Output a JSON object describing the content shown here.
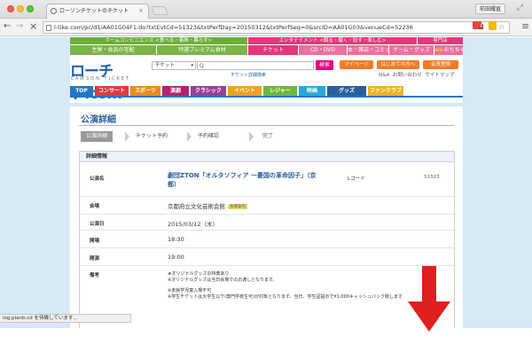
{
  "browser": {
    "tab_title": "ローソンチケットのチケット",
    "profile_label": "前田耀直",
    "url": "l-tike.com/pc/d1/AA01G04F1.do?txtEvtCd=51323&txtPerfDay=20150312&txtPerfSeq=0&srcID=AA01G03&venueCd=52236",
    "status_text": "log.pianb.cd を待機しています..."
  },
  "header": {
    "categories_top": [
      {
        "label": "ホームコンビニエンス <食べる・着飾・暮らす>",
        "color": "#6aae3c"
      },
      {
        "label": "エンタテイメント <観る・聴く・話す・楽しむ>",
        "color": "#e7367a"
      },
      {
        "label": "専門店",
        "color": "#e7367a"
      }
    ],
    "categories_sub": [
      {
        "label": "生鮮・食品の宅配",
        "color": "#7bb54a"
      },
      {
        "label": "特選プレミアム食材",
        "color": "#7bb54a"
      },
      {
        "label": "チケット",
        "color": "#e7367a"
      },
      {
        "label": "CD・DVD",
        "color": "#ef6fa0"
      },
      {
        "label": "本・雑誌・コミック",
        "color": "#ef6fa0"
      },
      {
        "label": "ゲーム・グッズ",
        "color": "#ef6fa0"
      },
      {
        "label": "おもちゃ",
        "color": "#ef6fa0",
        "badge": "NEW"
      }
    ],
    "logo_main": "ローチケ.com",
    "logo_sub": "LAWSON TICKET",
    "search": {
      "select_value": "チケット",
      "query": "Q",
      "button_label": "検索",
      "detail_link": "チケット詳細検索"
    },
    "buttons": [
      {
        "label": "マイページ",
        "color": "#f07c2a"
      },
      {
        "label": "はじめての方へ",
        "color": "#f07c2a"
      },
      {
        "label": "会員登録",
        "color": "#f07c2a"
      }
    ],
    "links": [
      "Q&A",
      "お問い合わせ",
      "サイトマップ"
    ],
    "nav": [
      {
        "label": "TOP",
        "color": "#1e78c8"
      },
      {
        "label": "コンサート",
        "color": "#e03a3a"
      },
      {
        "label": "スポーツ",
        "color": "#f08a1a"
      },
      {
        "label": "演劇",
        "color": "#b5216b"
      },
      {
        "label": "クラシック",
        "color": "#9a3e9b"
      },
      {
        "label": "イベント",
        "color": "#f0a01a"
      },
      {
        "label": "レジャー",
        "color": "#6fb73a"
      },
      {
        "label": "映画",
        "color": "#2aa7d6"
      },
      {
        "label": "グッズ",
        "color": "#2b5ea0"
      },
      {
        "label": "ファンクラブ",
        "color": "#f0b41a"
      }
    ]
  },
  "main": {
    "title": "公演詳細",
    "steps": [
      "公演詳細",
      "チケット予約",
      "予約確認",
      "完了"
    ],
    "detail_heading": "詳細情報",
    "rows": {
      "performance_label": "公演名",
      "performance_name": "劇団ZTON「オルタソフィア ー憂国の革命因子」（京都）",
      "lcode_label": "Lコード",
      "lcode_value": "51323",
      "venue_label": "会場",
      "venue_value": "京都府立文化芸術会館",
      "venue_badge": "会場案内",
      "date_label": "公演日",
      "date_value": "2015/03/12（木）",
      "open_label": "開場",
      "open_value": "18:30",
      "start_label": "開演",
      "start_value": "19:00",
      "notes_label": "備考",
      "note_lines": [
        "★オリジナルグッズの特典あり",
        "※オリジナルグッズは当日会場でのお渡しとなります。",
        "",
        "※未就学児童入場不可",
        "※学生チケットは大学生以下(専門学校生可)が対象となります。当日、学生証提示で¥1,000キャッシュバック致します"
      ]
    }
  },
  "colors": {
    "page_bg": "#d7e9f4",
    "accent_blue": "#2b5ea0",
    "arrow_red": "#e02020"
  }
}
